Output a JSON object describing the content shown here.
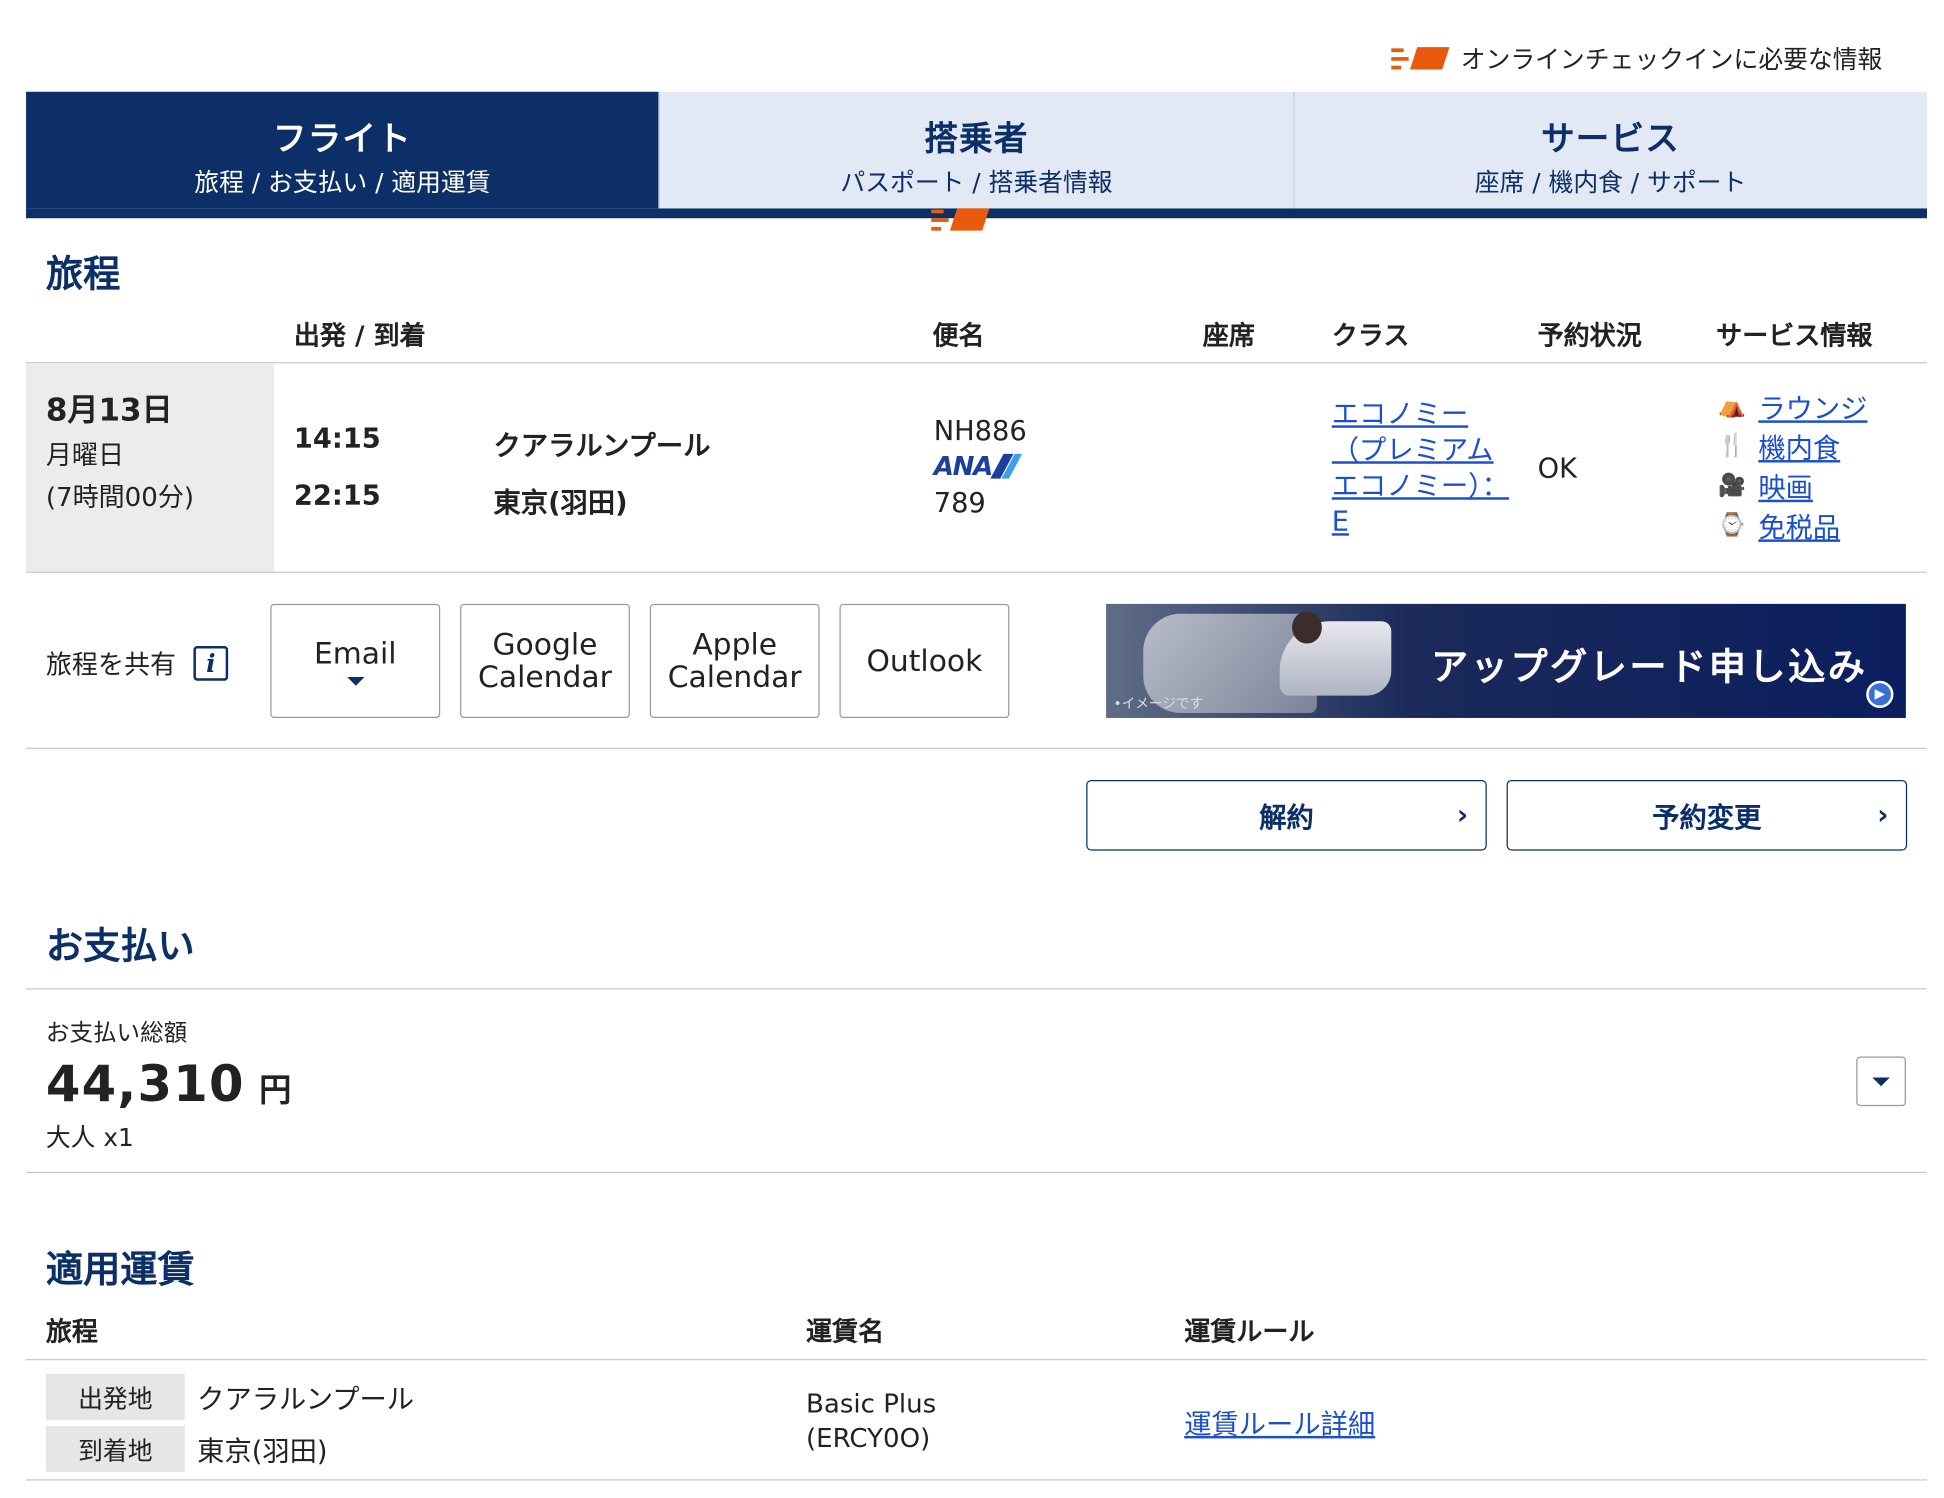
{
  "checkin": {
    "label": "オンラインチェックインに必要な情報",
    "icon": "ticket-icon"
  },
  "tabs": [
    {
      "title": "フライト",
      "sub": "旅程 / お支払い / 適用運賃",
      "active": true
    },
    {
      "title": "搭乗者",
      "sub": "パスポート / 搭乗者情報",
      "active": false
    },
    {
      "title": "サービス",
      "sub": "座席 / 機内食 / サポート",
      "active": false
    }
  ],
  "itinerary": {
    "title": "旅程",
    "headers": {
      "depart_arrive": "出発 / 到着",
      "flight": "便名",
      "seat": "座席",
      "class": "クラス",
      "status": "予約状況",
      "service": "サービス情報"
    },
    "row": {
      "date": "8月13日",
      "weekday": "月曜日",
      "duration": "(7時間00分)",
      "dep_time": "14:15",
      "dep_city": "クアラルンプール",
      "arr_time": "22:15",
      "arr_city": "東京(羽田)",
      "flight_no": "NH886",
      "airline_logo": "ANA",
      "aircraft": "789",
      "class_l1": "エコノミー",
      "class_l2": "（プレミアム",
      "class_l3": "エコノミー）：",
      "class_l4": "E",
      "status": "OK",
      "services": [
        {
          "label": "ラウンジ",
          "icon": "lounge-icon"
        },
        {
          "label": "機内食",
          "icon": "meal-icon"
        },
        {
          "label": "映画",
          "icon": "movie-icon"
        },
        {
          "label": "免税品",
          "icon": "duty-free-icon"
        }
      ]
    },
    "share": {
      "label": "旅程を共有",
      "info_icon": "info-icon",
      "email": "Email",
      "google_l1": "Google",
      "google_l2": "Calendar",
      "apple_l1": "Apple",
      "apple_l2": "Calendar",
      "outlook": "Outlook"
    },
    "banner": {
      "text": "アップグレード申し込み",
      "note": "•イメージです"
    },
    "cancel_label": "解約",
    "change_label": "予約変更"
  },
  "payment": {
    "title": "お支払い",
    "total_label": "お支払い総額",
    "amount": "44,310",
    "currency": "円",
    "passengers": "大人 x1"
  },
  "fare": {
    "title": "適用運賃",
    "headers": {
      "itinerary": "旅程",
      "fare_name": "運賃名",
      "fare_rules": "運賃ルール"
    },
    "origin_tag": "出発地",
    "origin": "クアラルンプール",
    "dest_tag": "到着地",
    "dest": "東京(羽田)",
    "fare_name_l1": "Basic Plus",
    "fare_name_l2": "(ERCY0O)",
    "rules_link": "運賃ルール詳細"
  },
  "colors": {
    "navy": "#0b2f66",
    "tab_inactive": "#e2e8f4",
    "link": "#1a4fd0",
    "accent_orange": "#ea5a0c"
  }
}
